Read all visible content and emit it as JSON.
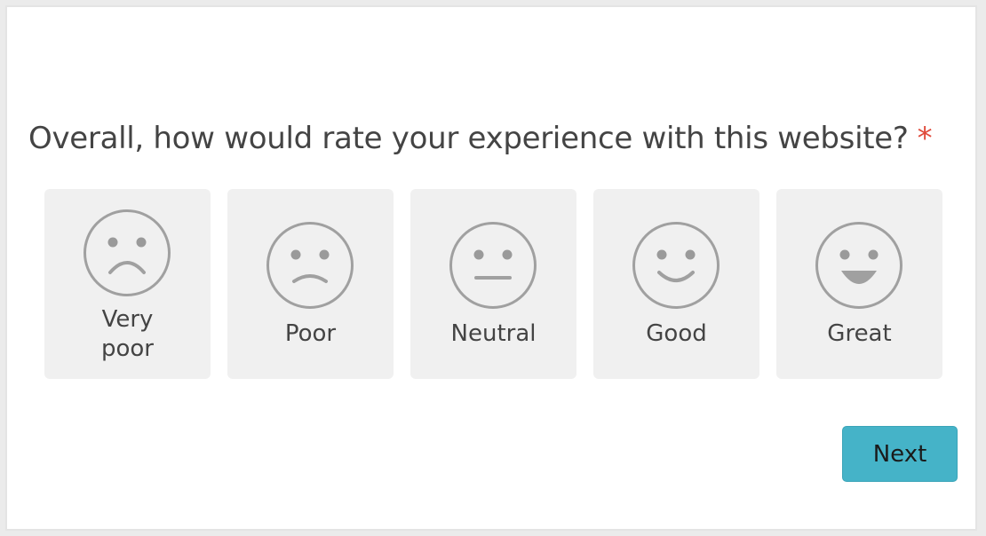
{
  "question": {
    "text": "Overall, how would rate your experience with this website?",
    "required_marker": "*"
  },
  "options": [
    {
      "label": "Very poor",
      "icon": "very-poor-face-icon"
    },
    {
      "label": "Poor",
      "icon": "poor-face-icon"
    },
    {
      "label": "Neutral",
      "icon": "neutral-face-icon"
    },
    {
      "label": "Good",
      "icon": "good-face-icon"
    },
    {
      "label": "Great",
      "icon": "great-face-icon"
    }
  ],
  "next_button": {
    "label": "Next"
  },
  "colors": {
    "option_background": "#f0f0f0",
    "face_stroke": "#a0a0a0",
    "required": "#e04a3b",
    "next_button": "#45b3c8"
  }
}
